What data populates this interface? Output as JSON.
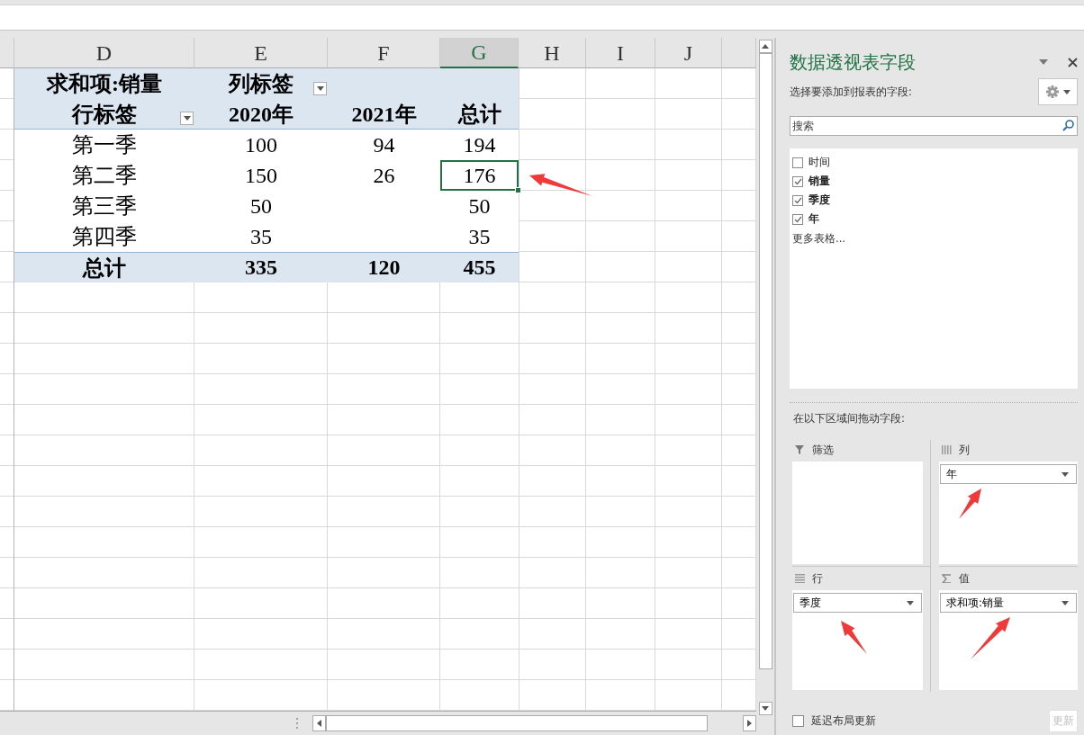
{
  "sheet": {
    "columns": [
      {
        "label": "D",
        "selected": false
      },
      {
        "label": "E",
        "selected": false
      },
      {
        "label": "F",
        "selected": false
      },
      {
        "label": "G",
        "selected": true
      },
      {
        "label": "H",
        "selected": false
      },
      {
        "label": "I",
        "selected": false
      },
      {
        "label": "J",
        "selected": false
      }
    ],
    "pivot": [
      {
        "kind": "header",
        "cells": [
          {
            "text": "求和项:销量",
            "selected": false
          },
          {
            "text": "列标签",
            "filter": true,
            "selected": false
          },
          {
            "selected": false
          },
          {
            "selected": false
          }
        ]
      },
      {
        "kind": "header",
        "cells": [
          {
            "text": "行标签",
            "filter": true,
            "selected": false
          },
          {
            "text": "2020年",
            "selected": false
          },
          {
            "text": "2021年",
            "selected": false
          },
          {
            "text": "总计",
            "selected": false
          }
        ]
      },
      {
        "kind": "data",
        "cells": [
          {
            "text": "第一季",
            "selected": false
          },
          {
            "text": "100",
            "selected": false
          },
          {
            "text": "94",
            "selected": false
          },
          {
            "text": "194",
            "selected": false
          }
        ]
      },
      {
        "kind": "data",
        "cells": [
          {
            "text": "第二季",
            "selected": false
          },
          {
            "text": "150",
            "selected": false
          },
          {
            "text": "26",
            "selected": false
          },
          {
            "text": "176",
            "selected": true
          }
        ]
      },
      {
        "kind": "data",
        "cells": [
          {
            "text": "第三季",
            "selected": false
          },
          {
            "text": "50",
            "selected": false
          },
          {
            "selected": false
          },
          {
            "text": "50",
            "selected": false
          }
        ]
      },
      {
        "kind": "data",
        "cells": [
          {
            "text": "第四季",
            "selected": false
          },
          {
            "text": "35",
            "selected": false
          },
          {
            "selected": false
          },
          {
            "text": "35",
            "selected": false
          }
        ]
      },
      {
        "kind": "total",
        "cells": [
          {
            "text": "总计",
            "selected": false
          },
          {
            "text": "335",
            "selected": false
          },
          {
            "text": "120",
            "selected": false
          },
          {
            "text": "455",
            "selected": false
          }
        ]
      }
    ]
  },
  "pane": {
    "title": "数据透视表字段",
    "subtitle": "选择要添加到报表的字段:",
    "search": {
      "placeholder": "搜索"
    },
    "fields": [
      {
        "label": "时间",
        "checked": false
      },
      {
        "label": "销量",
        "checked": true
      },
      {
        "label": "季度",
        "checked": true
      },
      {
        "label": "年",
        "checked": true
      }
    ],
    "more_tables": "更多表格...",
    "drag_hint": "在以下区域间拖动字段:",
    "areas": [
      {
        "kind": "filter",
        "label": "筛选"
      },
      {
        "kind": "columns",
        "label": "列",
        "items": [
          "年"
        ]
      },
      {
        "kind": "rows",
        "label": "行",
        "items": [
          "季度"
        ]
      },
      {
        "kind": "values",
        "label": "值",
        "items": [
          "求和项:销量"
        ]
      }
    ],
    "defer_update": {
      "label": "延迟布局更新",
      "checked": false
    },
    "update_button": {
      "label": "更新",
      "disabled": true
    }
  }
}
